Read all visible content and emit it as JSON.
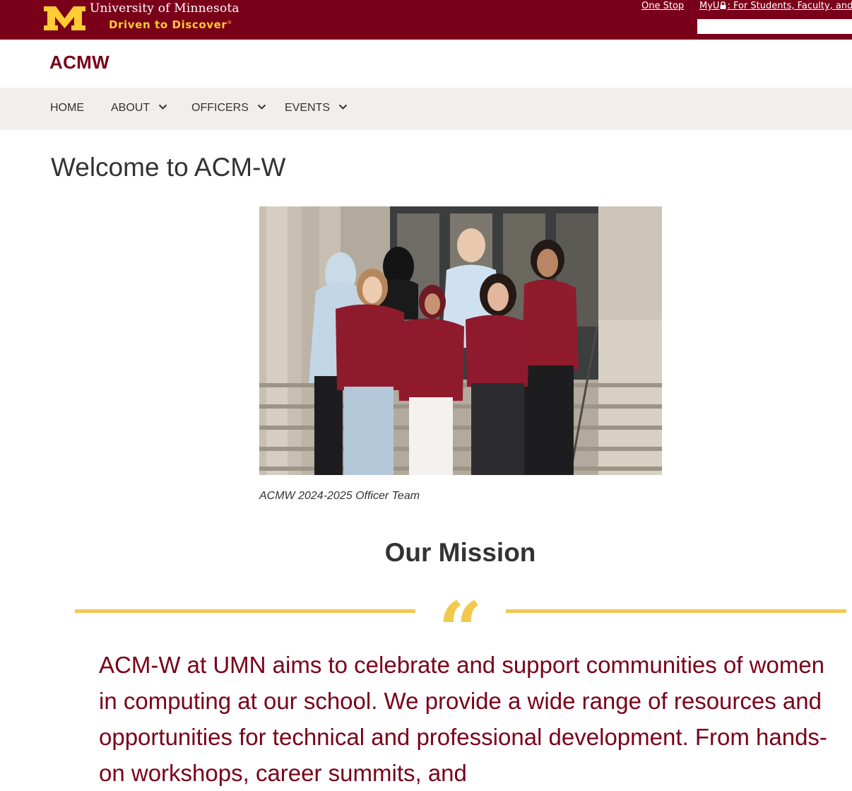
{
  "header": {
    "university_name": "University of Minnesota",
    "tagline": "Driven to Discover",
    "tagline_mark": "®",
    "links": {
      "one_stop": "One Stop",
      "myu_prefix": "MyU",
      "myu_suffix": ": For Students, Faculty, and Staff"
    },
    "search": {
      "value": "",
      "placeholder": ""
    }
  },
  "site": {
    "name": "ACMW"
  },
  "nav": {
    "items": [
      {
        "label": "HOME",
        "has_dropdown": false
      },
      {
        "label": "ABOUT",
        "has_dropdown": true
      },
      {
        "label": "OFFICERS",
        "has_dropdown": true
      },
      {
        "label": "EVENTS",
        "has_dropdown": true
      }
    ]
  },
  "main": {
    "title": "Welcome to ACM-W",
    "photo_caption": "ACMW 2024-2025 Officer Team",
    "mission": {
      "heading": "Our Mission",
      "quote_glyph": "“",
      "text": "ACM-W at UMN aims to celebrate and support communities of women in computing at our school. We provide a wide range of resources and opportunities for technical and professional development. From hands-on workshops, career summits, and"
    }
  },
  "colors": {
    "maroon": "#7a0019",
    "gold": "#ffcc33",
    "rule_gold": "#f1c94f",
    "nav_bg": "#f0efee",
    "text": "#333333"
  },
  "icons": [
    "block-m-logo-icon",
    "lock-icon",
    "chevron-down-icon",
    "quote-mark-icon"
  ]
}
